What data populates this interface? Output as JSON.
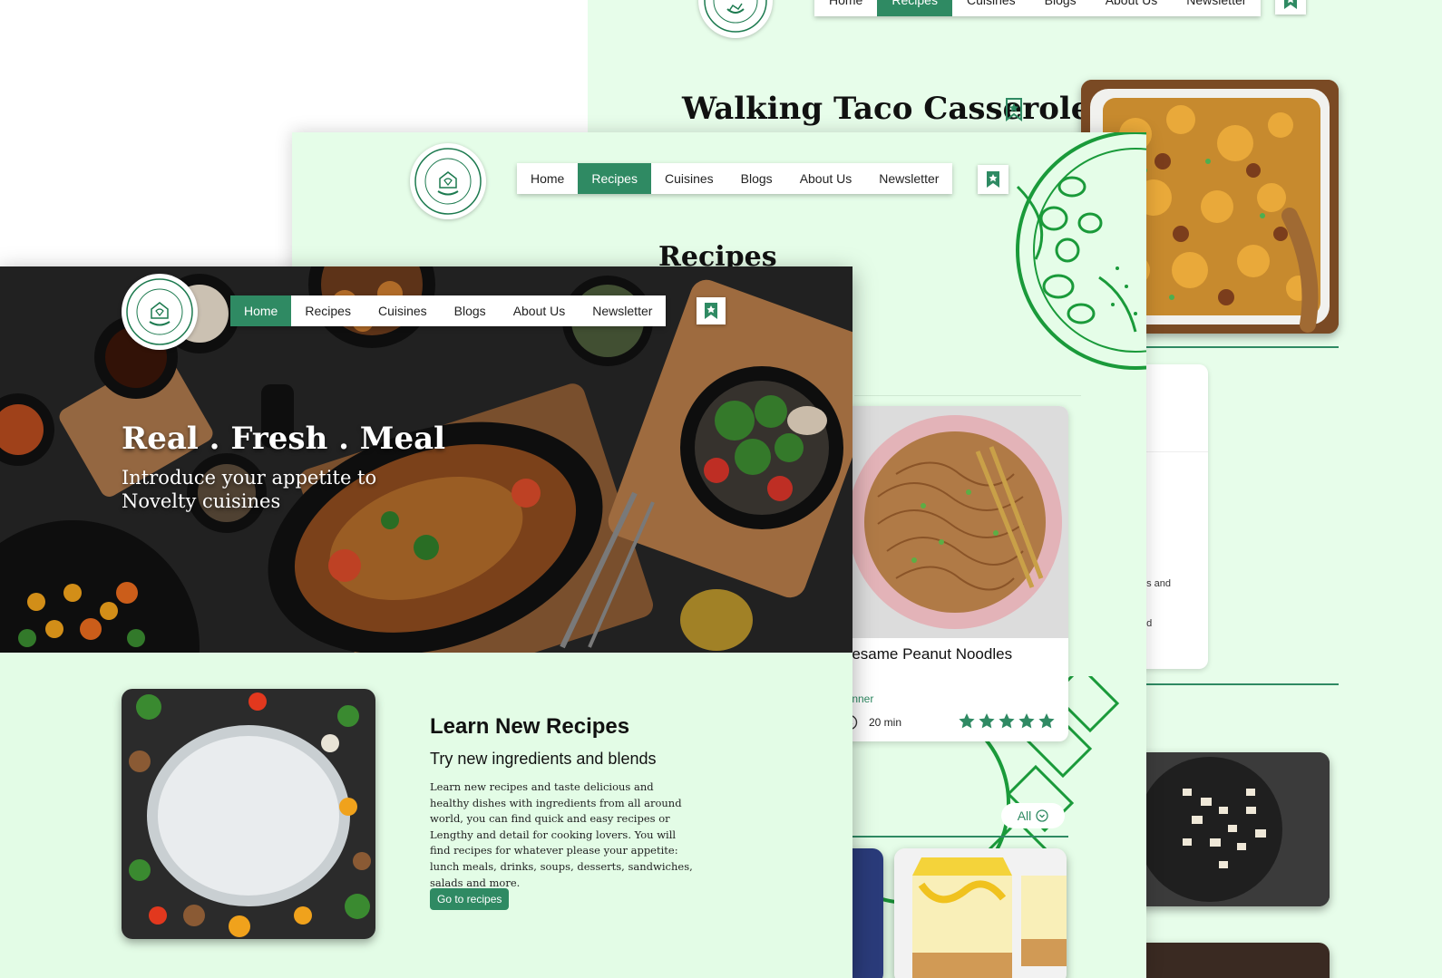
{
  "brand": {
    "logo_text_top": "HEALTHY & HAPPY",
    "logo_text_bottom": "HEALTHY & HAPPY"
  },
  "colors": {
    "accent": "#2f8a63",
    "page_bg": "#e5fde8",
    "line_art": "#1a9a3a"
  },
  "nav": {
    "items": [
      {
        "label": "Home"
      },
      {
        "label": "Recipes"
      },
      {
        "label": "Cuisines"
      },
      {
        "label": "Blogs"
      },
      {
        "label": "About Us"
      },
      {
        "label": "Newsletter"
      }
    ],
    "bookmark_icon": "bookmark-star-icon"
  },
  "detail_page": {
    "recipe_title": "Walking Taco Casserole",
    "partial_text_1": "es and",
    "partial_text_2": "ed"
  },
  "recipes_page": {
    "title": "Recipes",
    "card": {
      "name": "Sesame Peanut Noodles",
      "category": "Dinner",
      "time": "20 min",
      "rating": 5,
      "rating_max": 5
    },
    "filter_label": "All"
  },
  "home_page": {
    "hero_headline": "Real . Fresh . Meal",
    "hero_subline_1": "Introduce your appetite to",
    "hero_subline_2": "Novelty cuisines",
    "section_title": "Learn New Recipes",
    "section_subtitle": "Try new ingredients and blends",
    "section_body": "Learn new recipes and taste delicious and healthy dishes with ingredients from all around world, you can find quick and easy recipes or Lengthy and detail for cooking lovers. You will find recipes for whatever please your appetite: lunch meals, drinks, soups, desserts, sandwiches, salads and more.",
    "cta_label": "Go to recipes"
  }
}
